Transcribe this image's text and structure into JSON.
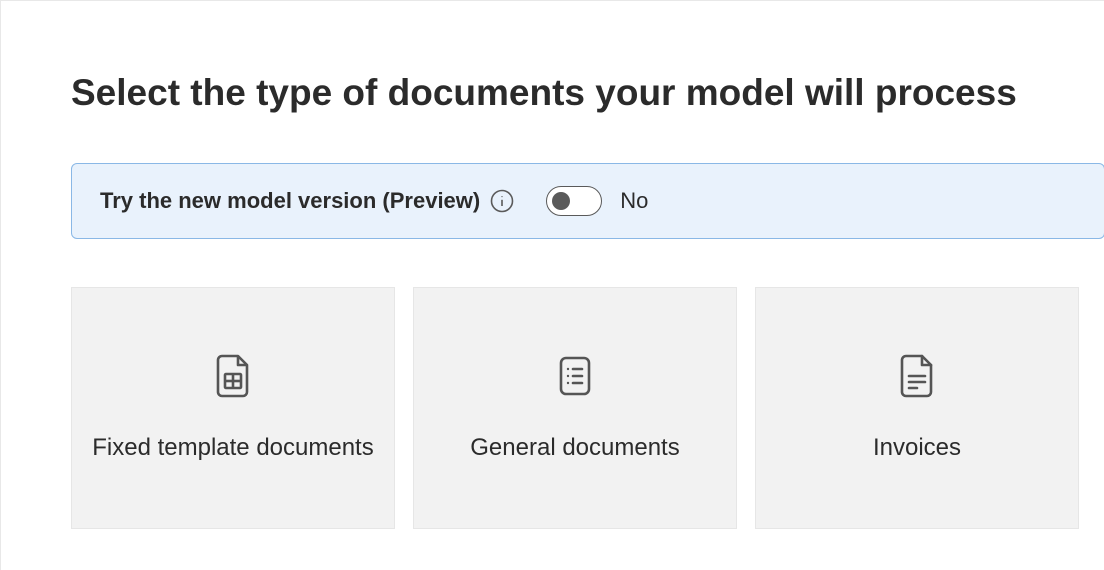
{
  "title": "Select the type of documents your model will process",
  "preview": {
    "label": "Try the new model version (Preview)",
    "toggle_state_label": "No",
    "enabled": false
  },
  "cards": [
    {
      "id": "fixed-template",
      "label": "Fixed template documents",
      "icon": "file-table-icon"
    },
    {
      "id": "general-documents",
      "label": "General documents",
      "icon": "file-bullets-icon"
    },
    {
      "id": "invoices",
      "label": "Invoices",
      "icon": "file-lines-icon"
    }
  ]
}
